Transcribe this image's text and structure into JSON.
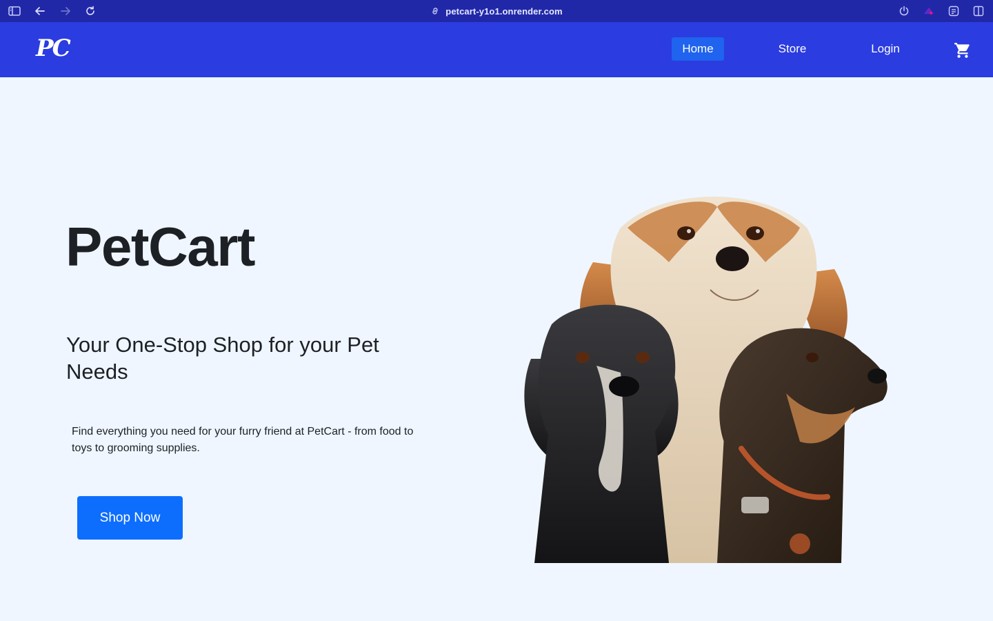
{
  "browser": {
    "url": "petcart-y1o1.onrender.com",
    "icons": [
      "sidebar-toggle-icon",
      "back-arrow-icon",
      "forward-arrow-icon",
      "reload-icon",
      "link-icon",
      "power-icon",
      "extension-icon",
      "translate-icon",
      "split-view-icon"
    ]
  },
  "navbar": {
    "logo": "PC",
    "links": [
      {
        "label": "Home",
        "active": true
      },
      {
        "label": "Store",
        "active": false
      },
      {
        "label": "Login",
        "active": false
      }
    ],
    "cart_icon": "shopping-cart-icon"
  },
  "hero": {
    "title": "PetCart",
    "subtitle": "Your One-Stop Shop for your Pet Needs",
    "description": "Find everything you need for your furry friend at PetCart - from food to toys to grooming supplies.",
    "cta_label": "Shop Now",
    "image_alt": "three dogs illustration"
  },
  "colors": {
    "chrome": "#2128a8",
    "navbar": "#2b3ce0",
    "active_link": "#1f63ee",
    "page_bg": "#eff6ff",
    "button": "#0d6efd",
    "text": "#1d2125"
  }
}
